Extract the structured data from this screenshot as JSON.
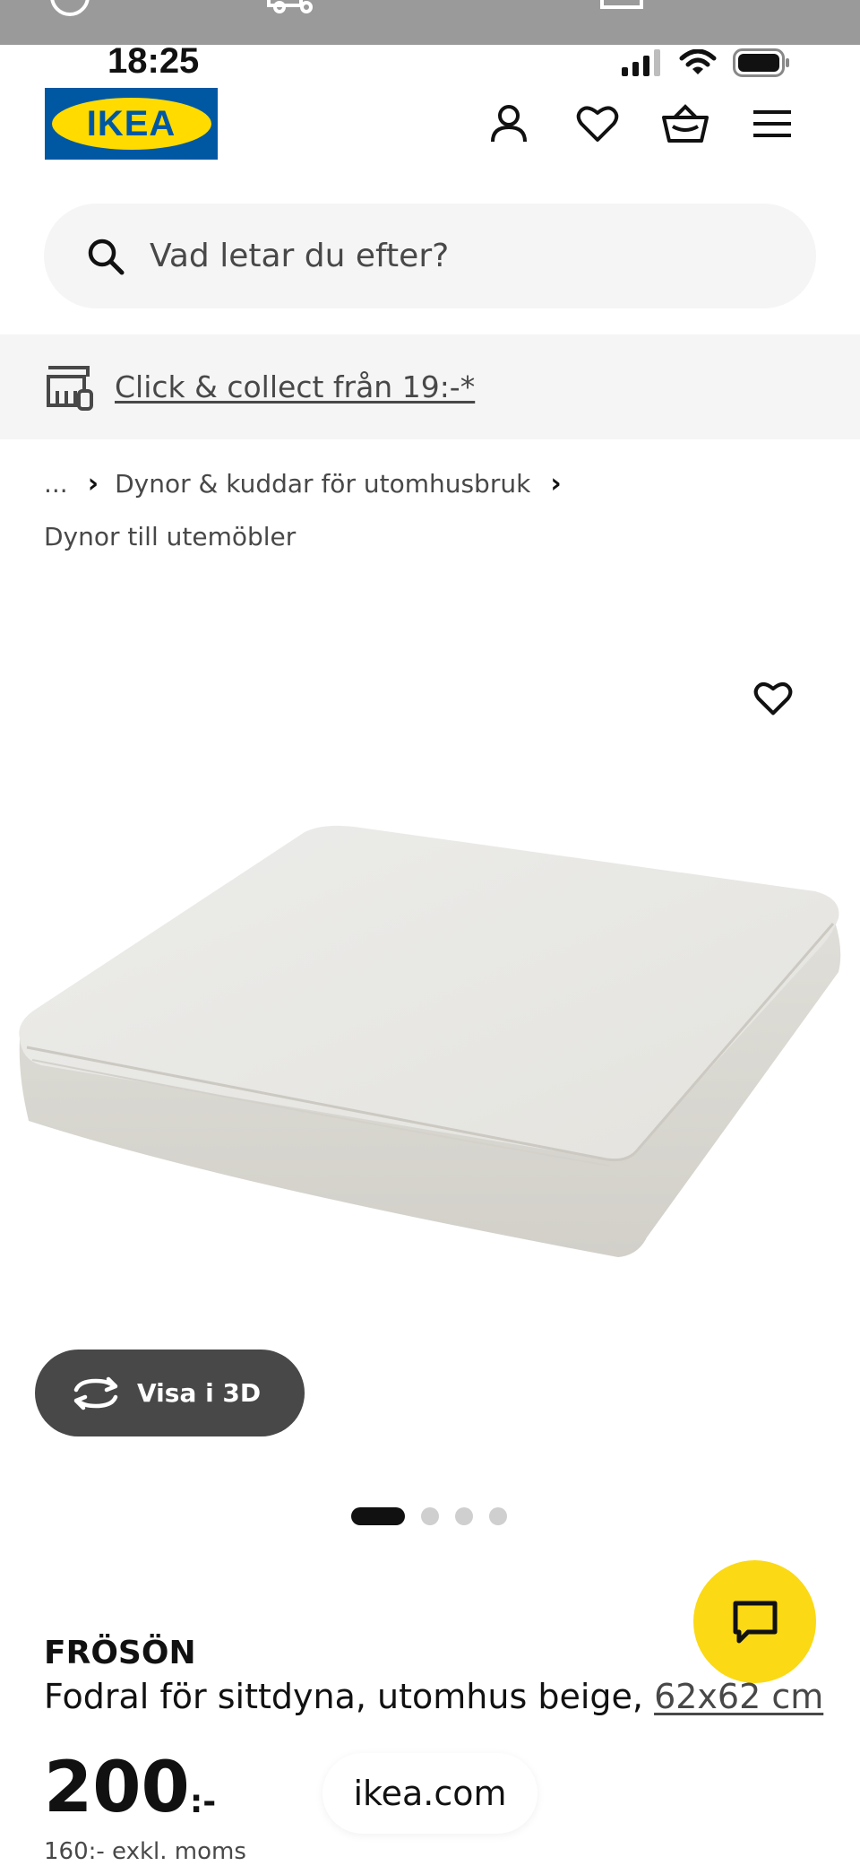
{
  "status_bar": {
    "time": "18:25"
  },
  "header": {
    "logo_text": "IKEA",
    "icons": [
      "profile-icon",
      "heart-icon",
      "basket-icon",
      "menu-icon"
    ]
  },
  "search": {
    "placeholder": "Vad letar du efter?"
  },
  "promo": {
    "link": "Click & collect från 19:-*",
    "icon": "store-pickup-icon"
  },
  "breadcrumb": {
    "ellipsis": "...",
    "items": [
      "Dynor & kuddar för utomhusbruk",
      "Dynor till utemöbler"
    ]
  },
  "gallery": {
    "view3d_label": "Visa i 3D",
    "slide_count": 4,
    "active_slide": 1
  },
  "product": {
    "name": "FRÖSÖN",
    "description": "Fodral för sittdyna, utomhus beige, ",
    "size_link": "62x62 cm",
    "price": "200",
    "price_suffix": ":-",
    "price_ex_vat": "160:- exkl. moms"
  },
  "browser": {
    "domain": "ikea.com"
  },
  "colors": {
    "ikea_blue": "#0058a3",
    "ikea_yellow": "#ffdb00",
    "chat_yellow": "#fbd914",
    "text_dark": "#111111",
    "text_grey": "#484848",
    "bar_grey": "#f5f5f5"
  }
}
